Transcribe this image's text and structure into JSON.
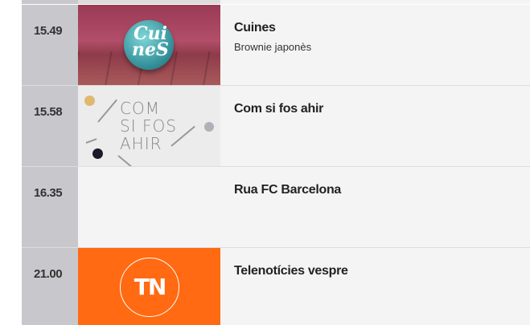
{
  "schedule": {
    "items": [
      {
        "time": "15.49",
        "title": "Cuines",
        "subtitle": "Brownie japonès",
        "thumbnail": {
          "icon": "cuines-logo-thumbnail",
          "text": "Cuines"
        }
      },
      {
        "time": "15.58",
        "title": "Com si fos ahir",
        "subtitle": "",
        "thumbnail": {
          "icon": "com-si-fos-ahir-thumbnail",
          "words": [
            "COM",
            "SI FOS",
            "AHIR"
          ]
        }
      },
      {
        "time": "16.35",
        "title": "Rua FC Barcelona",
        "subtitle": "",
        "thumbnail": null
      },
      {
        "time": "21.00",
        "title": "Telenotícies vespre",
        "subtitle": "",
        "thumbnail": {
          "icon": "tn-logo-thumbnail",
          "text": "TN"
        }
      }
    ]
  },
  "colors": {
    "time_column": "#c8c8cc",
    "row_background": "#f4f4f4",
    "tn_orange": "#ff6a13",
    "cuines_pink": "#b24e6a"
  }
}
